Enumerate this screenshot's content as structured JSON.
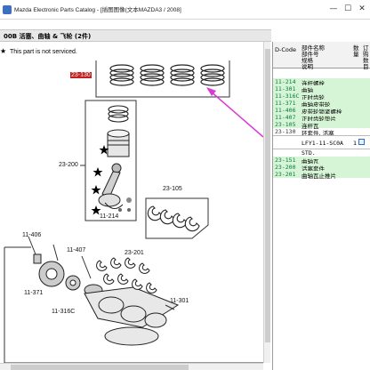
{
  "window": {
    "title": "Mazda Electronic Parts Catalog - [插图图像(文本MAZDA3 / 2008]",
    "minimize": "—",
    "maximize": "☐",
    "close": "✕"
  },
  "section": {
    "title": "00B  活塞、曲轴 & 飞轮 (2件)"
  },
  "notice": {
    "star": "★",
    "text": "This part is not serviced."
  },
  "diagram_labels": {
    "l23130": "23-130",
    "l23200": "23-200",
    "l23105": "23-105",
    "l11214": "11-214",
    "l11406": "11-406",
    "l11407": "11-407",
    "l23201": "23-201",
    "l11371": "11-371",
    "l11316c": "11-316C",
    "l11301": "11-301"
  },
  "panel": {
    "header": {
      "code": "D-Code",
      "name_lines": [
        "部件名称",
        "部件号",
        "规格",
        "说明"
      ],
      "qty_lines": [
        "数",
        "量"
      ],
      "order_lines": [
        "订",
        "购",
        "数",
        "目"
      ]
    },
    "rows": [
      {
        "code": "11-214",
        "name": "连杆螺栓",
        "style": "green"
      },
      {
        "code": "11-301",
        "name": "曲轴",
        "style": "green"
      },
      {
        "code": "11-316C",
        "name": "正时齿轮",
        "style": "green"
      },
      {
        "code": "11-371",
        "name": "曲轴皮带轮",
        "style": "green"
      },
      {
        "code": "11-406",
        "name": "皮带轮锁紧螺栓",
        "style": "green"
      },
      {
        "code": "11-407",
        "name": "正时齿轮垫片",
        "style": "green"
      },
      {
        "code": "23-105",
        "name": "连杆瓦",
        "style": "green"
      },
      {
        "code": "23-130",
        "name": "环套件, 活塞",
        "style": "plain"
      }
    ],
    "selected": {
      "code": "",
      "name": "LFY1-11-SC0A",
      "qty": "1"
    },
    "std_row": {
      "code": "",
      "name": "STD."
    },
    "rows2": [
      {
        "code": "23-151",
        "name": "曲轴瓦",
        "style": "green"
      },
      {
        "code": "23-200",
        "name": "活塞套件",
        "style": "green"
      },
      {
        "code": "23-201",
        "name": "曲轴瓦止推片",
        "style": "green"
      }
    ]
  }
}
